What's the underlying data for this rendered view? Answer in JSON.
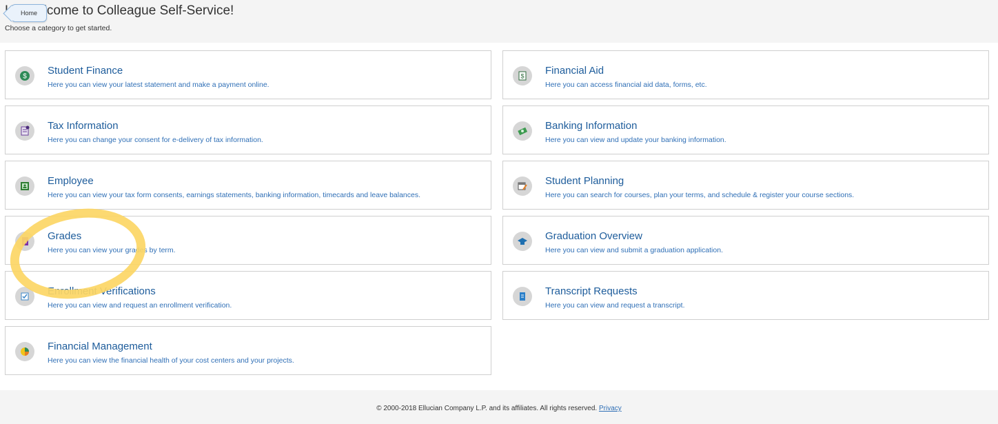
{
  "header": {
    "welcome_text": "Hi, Welcome to Colleague Self-Service!",
    "subtitle": "Choose a category to get started.",
    "home_tooltip": "Home"
  },
  "cards": [
    {
      "title": "Student Finance",
      "description": "Here you can view your latest statement and make a payment online.",
      "icon": "dollar-coin-icon",
      "column": "left"
    },
    {
      "title": "Financial Aid",
      "description": "Here you can access financial aid data, forms, etc.",
      "icon": "money-bill-icon",
      "column": "right"
    },
    {
      "title": "Tax Information",
      "description": "Here you can change your consent for e-delivery of tax information.",
      "icon": "tax-document-icon",
      "column": "left"
    },
    {
      "title": "Banking Information",
      "description": "Here you can view and update your banking information.",
      "icon": "money-stack-icon",
      "column": "right"
    },
    {
      "title": "Employee",
      "description": "Here you can view your tax form consents, earnings statements, banking information, timecards and leave balances.",
      "icon": "employee-badge-icon",
      "column": "left"
    },
    {
      "title": "Student Planning",
      "description": "Here you can search for courses, plan your terms, and schedule & register your course sections.",
      "icon": "calendar-pencil-icon",
      "column": "right"
    },
    {
      "title": "Grades",
      "description": "Here you can view your grades by term.",
      "icon": "grade-book-icon",
      "column": "left"
    },
    {
      "title": "Graduation Overview",
      "description": "Here you can view and submit a graduation application.",
      "icon": "graduation-cap-icon",
      "column": "right"
    },
    {
      "title": "Enrollment Verifications",
      "description": "Here you can view and request an enrollment verification.",
      "icon": "checklist-icon",
      "column": "left"
    },
    {
      "title": "Transcript Requests",
      "description": "Here you can view and request a transcript.",
      "icon": "transcript-icon",
      "column": "right"
    },
    {
      "title": "Financial Management",
      "description": "Here you can view the financial health of your cost centers and your projects.",
      "icon": "pie-chart-icon",
      "column": "left"
    }
  ],
  "footer": {
    "copyright": "© 2000-2018 Ellucian Company L.P. and its affiliates. All rights reserved.",
    "privacy_link": "Privacy"
  },
  "colors": {
    "link_blue": "#1d5c9b",
    "highlight_yellow": "#fcd665",
    "icon_bg": "#d6d6d6"
  }
}
